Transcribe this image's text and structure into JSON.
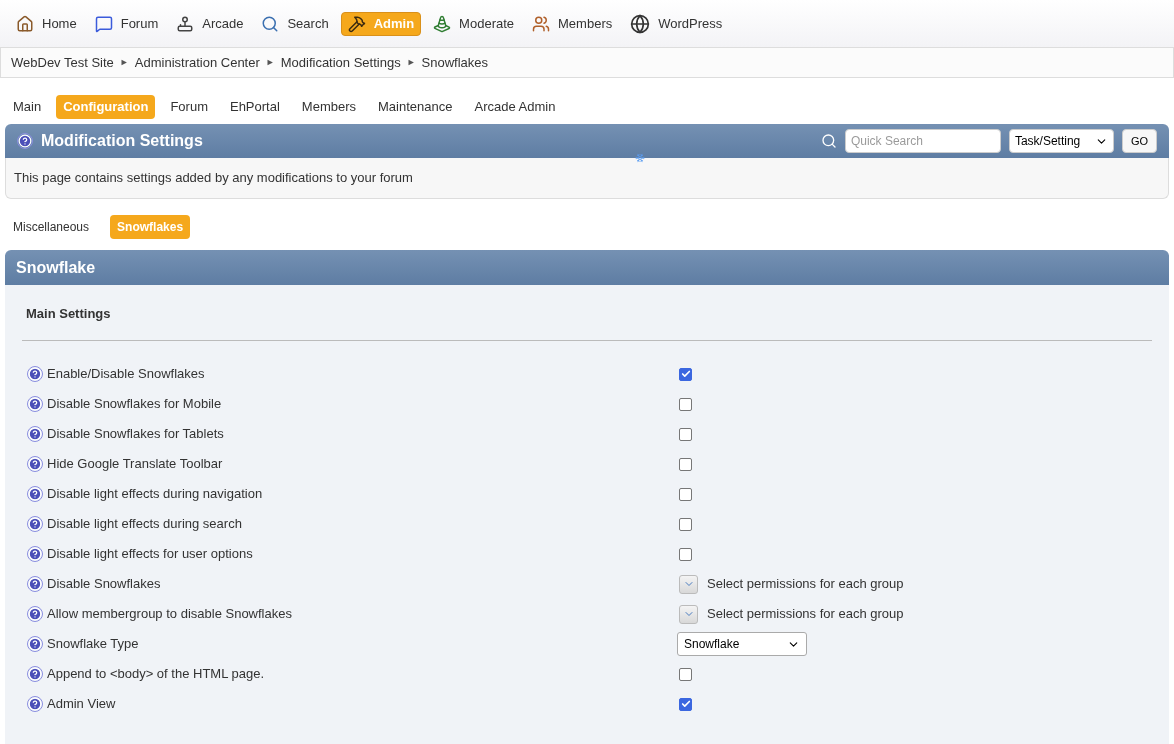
{
  "top_menu": [
    {
      "label": "Home",
      "selected": false
    },
    {
      "label": "Forum",
      "selected": false
    },
    {
      "label": "Arcade",
      "selected": false
    },
    {
      "label": "Search",
      "selected": false
    },
    {
      "label": "Admin",
      "selected": true
    },
    {
      "label": "Moderate",
      "selected": false
    },
    {
      "label": "Members",
      "selected": false
    },
    {
      "label": "WordPress",
      "selected": false
    }
  ],
  "breadcrumb": [
    "WebDev Test Site",
    "Administration Center",
    "Modification Settings",
    "Snowflakes"
  ],
  "breadcrumb_separator": "►",
  "admin_tabs": [
    {
      "label": "Main",
      "selected": false
    },
    {
      "label": "Configuration",
      "selected": true
    },
    {
      "label": "Forum",
      "selected": false
    },
    {
      "label": "EhPortal",
      "selected": false
    },
    {
      "label": "Members",
      "selected": false
    },
    {
      "label": "Maintenance",
      "selected": false
    },
    {
      "label": "Arcade Admin",
      "selected": false
    }
  ],
  "section": {
    "title": "Modification Settings",
    "quick_search": {
      "placeholder": "Quick Search"
    },
    "search_type": "Task/Setting",
    "go_button": "GO",
    "description": "This page contains settings added by any modifications to your forum"
  },
  "sub_tabs": [
    {
      "label": "Miscellaneous",
      "selected": false
    },
    {
      "label": "Snowflakes",
      "selected": true
    }
  ],
  "panel": {
    "title": "Snowflake",
    "subheading": "Main Settings",
    "settings": [
      {
        "label": "Enable/Disable Snowflakes",
        "kind": "checkbox",
        "checked": true
      },
      {
        "label": "Disable Snowflakes for Mobile",
        "kind": "checkbox",
        "checked": false
      },
      {
        "label": "Disable Snowflakes for Tablets",
        "kind": "checkbox",
        "checked": false
      },
      {
        "label": "Hide Google Translate Toolbar",
        "kind": "checkbox",
        "checked": false
      },
      {
        "label": "Disable light effects during navigation",
        "kind": "checkbox",
        "checked": false
      },
      {
        "label": "Disable light effects during search",
        "kind": "checkbox",
        "checked": false
      },
      {
        "label": "Disable light effects for user options",
        "kind": "checkbox",
        "checked": false
      },
      {
        "label": "Disable Snowflakes",
        "kind": "permissions",
        "value": "Select permissions for each group"
      },
      {
        "label": "Allow membergroup to disable Snowflakes",
        "kind": "permissions",
        "value": "Select permissions for each group"
      },
      {
        "label": "Snowflake Type",
        "kind": "select",
        "value": "Snowflake"
      },
      {
        "label": "Append to <body> of the HTML page.",
        "kind": "checkbox",
        "checked": false
      },
      {
        "label": "Admin View",
        "kind": "checkbox",
        "checked": true
      }
    ]
  }
}
